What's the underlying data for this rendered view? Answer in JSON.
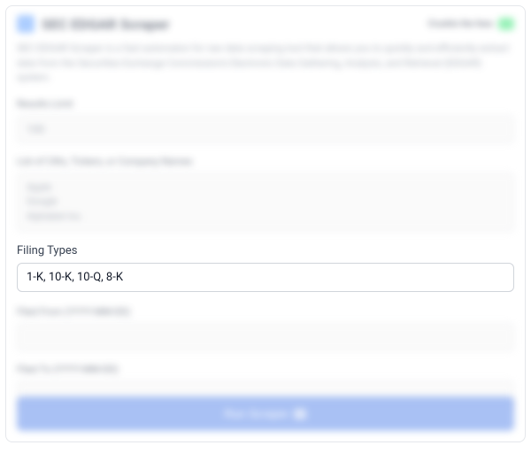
{
  "header": {
    "title": "SEC EDGAR Scraper",
    "live_label": "Crushin the fees"
  },
  "description": "SEC EDGAR Scraper is a fast automaton for raw data scraping tool that allows you to quickly and efficiently extract data from the Securities Exchange Commission's Electronic Data Gathering, Analysis, and Retrieval (EDGAR) system.",
  "fields": {
    "results_limit": {
      "label": "Results Limit",
      "value": "100"
    },
    "list": {
      "label": "List of CIKs, Tickers, or Company Names",
      "value": "Apple\nGoogle\nAlphabet Inc."
    },
    "filing_types": {
      "label": "Filing Types",
      "value": "1-K, 10-K, 10-Q, 8-K"
    },
    "filed_from": {
      "label": "Filed From (YYYY-MM-DD)",
      "value": ""
    },
    "filed_to": {
      "label": "Filed To (YYYY-MM-DD)",
      "value": ""
    }
  },
  "run_button": "Run Scraper"
}
